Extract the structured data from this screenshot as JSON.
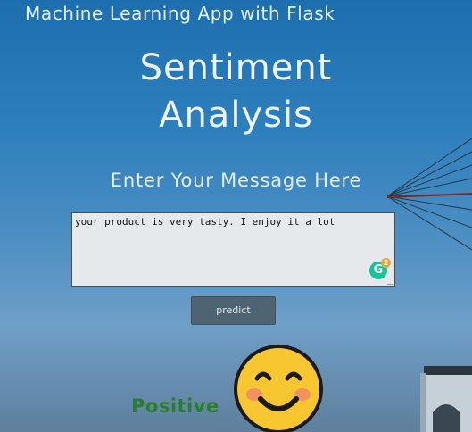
{
  "header": {
    "app_title": "Machine Learning App with Flask"
  },
  "main": {
    "title_line1": "Sentiment",
    "title_line2": "Analysis",
    "prompt": "Enter Your Message Here",
    "message": {
      "value": "your product is very tasty. I enjoy it a lot",
      "grammarly_icon": "grammarly-icon",
      "grammarly_count": "2"
    },
    "predict_label": "predict"
  },
  "result": {
    "label": "Positive",
    "label_color": "#2a7d2a",
    "emoji": "smiling-face-icon"
  }
}
